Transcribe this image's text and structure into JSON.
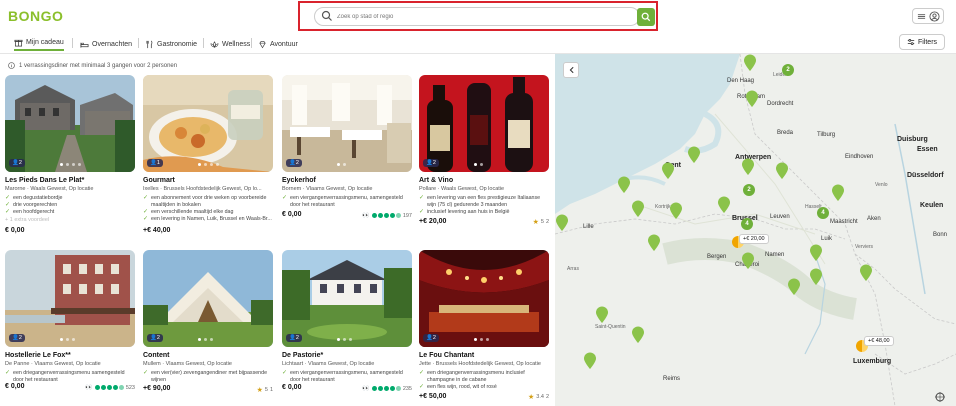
{
  "header": {
    "logo": "BONGO",
    "search_placeholder": "Zoek op stad of regio"
  },
  "tabs": [
    {
      "label": "Mijn cadeau",
      "icon": "gift-icon"
    },
    {
      "label": "Overnachten",
      "icon": "bed-icon"
    },
    {
      "label": "Gastronomie",
      "icon": "cutlery-icon"
    },
    {
      "label": "Wellness",
      "icon": "lotus-icon"
    },
    {
      "label": "Avontuur",
      "icon": "diamond-icon"
    }
  ],
  "filters_label": "Filters",
  "info_text": "1 verrassingsdiner met minimaal 3 gangen voor 2 personen",
  "cards": [
    {
      "title": "Les Pieds Dans Le Plat*",
      "location": "Marorne · Waals Gewest, Op locatie",
      "badge": "2",
      "features": [
        "een degustatiebordje",
        "drie voorgerechten",
        "een hoofdgerecht"
      ],
      "more": "+ 1 extra voordeel",
      "price": "€ 0,00",
      "rating": "",
      "rating_count": ""
    },
    {
      "title": "Gourmart",
      "location": "Ixelles · Brussels Hoofdstedelijk Gewest, Op lo...",
      "badge": "1",
      "features": [
        "een abonnement voor drie weken op voorbereide maaltijden in bokalen",
        "een verschillende maaltijd elke dag",
        "een levering in Namen, Luik, Brussel en Waals-Br..."
      ],
      "more": "",
      "price": "+€ 40,00",
      "rating": "",
      "rating_count": ""
    },
    {
      "title": "Eyckerhof",
      "location": "Bornem · Vlaams Gewest, Op locatie",
      "badge": "2",
      "features": [
        "een viergangenverrassingsmenu, samengesteld door het restaurant"
      ],
      "more": "",
      "price": "€ 0,00",
      "rating": "tripadvisor",
      "rating_count": "197"
    },
    {
      "title": "Art & Vino",
      "location": "Pollare · Waals Gewest, Op locatie",
      "badge": "2",
      "features": [
        "een levering van een fles prestigieuze Italiaanse wijn (75 cl) gedurende 3 maanden",
        "inclusief levering aan huis in België"
      ],
      "more": "",
      "price": "+€ 20,00",
      "rating": "5",
      "rating_count": "2"
    },
    {
      "title": "Hostellerie Le Fox**",
      "location": "De Panne · Vlaams Gewest, Op locatie",
      "badge": "2",
      "features": [
        "een driegangenverrassingsmenu samengesteld door het restaurant"
      ],
      "more": "",
      "price": "€ 0,00",
      "rating": "tripadvisor",
      "rating_count": "523"
    },
    {
      "title": "Content",
      "location": "Mullem · Vlaams Gewest, Op locatie",
      "badge": "2",
      "features": [
        "een vier(vier) zevengangendiner met bijpassende wijnen"
      ],
      "more": "",
      "price": "+€ 90,00",
      "rating": "5",
      "rating_count": "1"
    },
    {
      "title": "De Pastorie*",
      "location": "Lichtaart · Vlaams Gewest, Op locatie",
      "badge": "2",
      "features": [
        "een viergangenverrassingsmenu, samengesteld door het restaurant"
      ],
      "more": "",
      "price": "€ 0,00",
      "rating": "tripadvisor",
      "rating_count": "235"
    },
    {
      "title": "Le Fou Chantant",
      "location": "Jette · Brussels Hoofdstedelijk Gewest, Op locatie",
      "badge": "2",
      "features": [
        "een driegangenverrassingsmenu inclusief champagne in de cabane",
        "een fles wijn, rood, wit of rosé"
      ],
      "more": "",
      "price": "+€ 50,00",
      "rating": "3.4",
      "rating_count": "2"
    }
  ],
  "map": {
    "price_tags": [
      "+€ 20,00",
      "+€ 48,00"
    ],
    "clusters": [
      "2",
      "2",
      "4",
      "4"
    ],
    "cities": [
      "Den Haag",
      "Rotterdam",
      "Dordrecht",
      "Breda",
      "Tilburg",
      "Eindhoven",
      "Antwerpen",
      "Gent",
      "Brussel",
      "Namen",
      "Luik",
      "Bergen",
      "Charleroi",
      "Duisburg",
      "Essen",
      "Düsseldorf",
      "Keulen",
      "Bonn",
      "Aken",
      "Maastricht",
      "Leuven",
      "Kortrijk",
      "Hasselt",
      "Venlo",
      "Leiden",
      "Luxemburg",
      "Reims",
      "Saint-Quentin",
      "Lille",
      "Arras",
      "Verviers"
    ]
  }
}
